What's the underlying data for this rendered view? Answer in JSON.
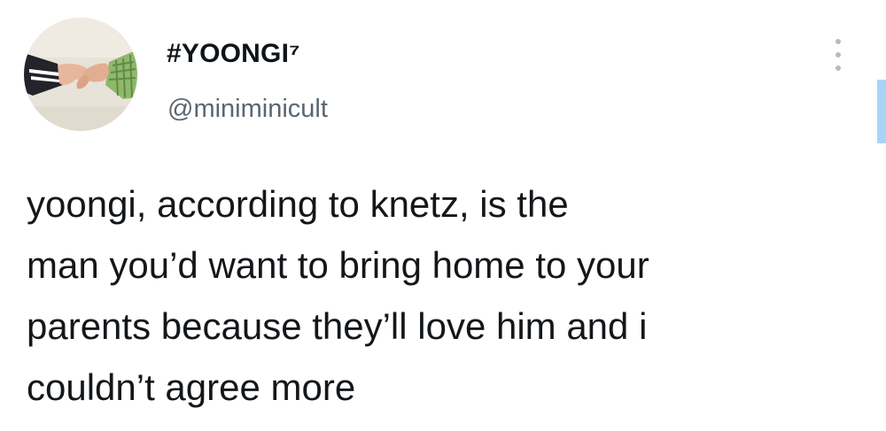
{
  "author": {
    "display_name": "#YOONGI⁷",
    "handle": "@miniminicult"
  },
  "tweet": {
    "lines": [
      "yoongi, according to knetz, is the",
      "man you’d want to bring home to your",
      "parents because they’ll love him and i",
      "couldn’t agree more"
    ]
  },
  "icons": {
    "more": "more-vertical-icon",
    "avatar": "avatar-image"
  },
  "colors": {
    "text": "#14171a",
    "handle": "#5b6670",
    "scroll_accent": "#a9d4f5"
  }
}
